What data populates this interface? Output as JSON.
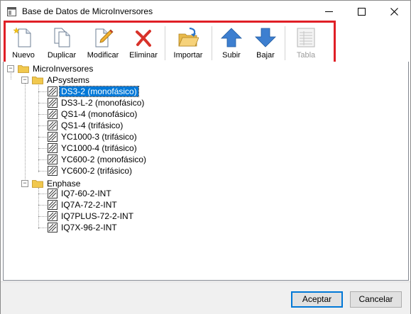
{
  "window": {
    "title": "Base de Datos de MicroInversores"
  },
  "toolbar": {
    "new_label": "Nuevo",
    "duplicate_label": "Duplicar",
    "modify_label": "Modificar",
    "delete_label": "Eliminar",
    "import_label": "Importar",
    "up_label": "Subir",
    "down_label": "Bajar",
    "table_label": "Tabla"
  },
  "tree": {
    "root": "MicroInversores",
    "groups": [
      {
        "label": "APsystems",
        "items": [
          "DS3-2 (monofásico)",
          "DS3-L-2 (monofásico)",
          "QS1-4 (monofásico)",
          "QS1-4 (trifásico)",
          "YC1000-3 (trifásico)",
          "YC1000-4 (trifásico)",
          "YC600-2 (monofásico)",
          "YC600-2 (trifásico)"
        ]
      },
      {
        "label": "Enphase",
        "items": [
          "IQ7-60-2-INT",
          "IQ7A-72-2-INT",
          "IQ7PLUS-72-2-INT",
          "IQ7X-96-2-INT"
        ]
      }
    ],
    "selected": "DS3-2 (monofásico)"
  },
  "buttons": {
    "accept_label": "Aceptar",
    "cancel_label": "Cancelar"
  },
  "colors": {
    "highlight": "#e01f26",
    "selection": "#0078d7",
    "accent": "#0078d7"
  }
}
